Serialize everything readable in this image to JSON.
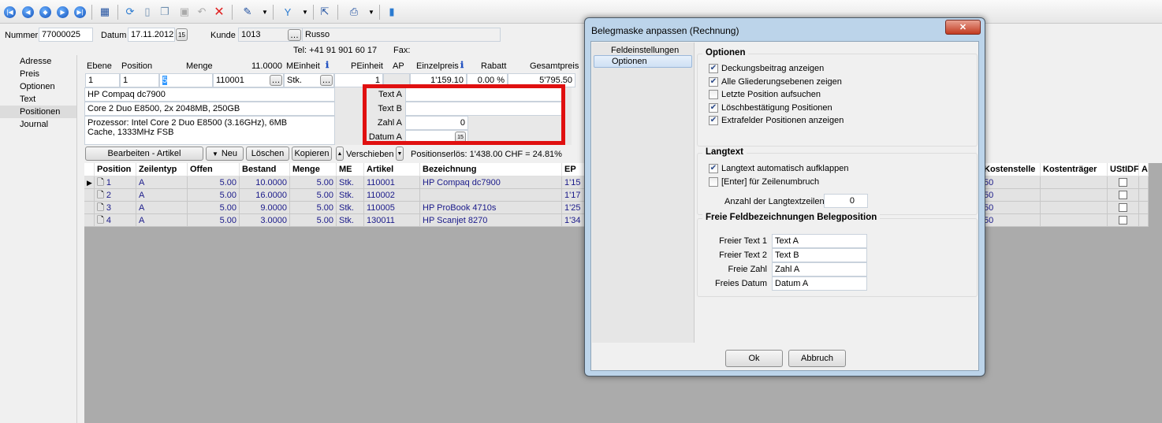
{
  "toolbar": {
    "icons": [
      "first-record-icon",
      "prev-record-icon",
      "goto-record-icon",
      "next-record-icon",
      "last-record-icon",
      "table-view-icon",
      "refresh-icon",
      "new-doc-icon",
      "copy-doc-icon",
      "save-icon",
      "undo-icon",
      "delete-icon",
      "pin-icon",
      "filter-icon",
      "pointer-icon",
      "print-icon",
      "book-icon"
    ]
  },
  "header": {
    "nummer_label": "Nummer",
    "nummer": "77000025",
    "datum_label": "Datum",
    "datum": "17.11.2012",
    "kunde_label": "Kunde",
    "kunde": "1013",
    "kunde_name": "Russo",
    "tel": "Tel: +41 91 901 60 17",
    "fax": "Fax:"
  },
  "leftnav": {
    "items": [
      "Adresse",
      "Preis",
      "Optionen",
      "Text",
      "Positionen",
      "Journal"
    ],
    "selected": "Positionen"
  },
  "pos": {
    "labels": {
      "ebene": "Ebene",
      "position": "Position",
      "menge": "Menge",
      "menge_total": "11.0000",
      "meinheit": "MEinheit",
      "peinheit": "PEinheit",
      "ap": "AP",
      "einzelpreis": "Einzelpreis",
      "rabatt": "Rabatt",
      "gesamtpreis": "Gesamtpreis"
    },
    "values": {
      "ebene": "1",
      "position": "1",
      "menge": "5",
      "artikel": "110001",
      "meinheit": "Stk.",
      "peinheit": "1",
      "einzelpreis": "1'159.10",
      "rabatt": "0.00 %",
      "gesamtpreis": "5'795.50"
    },
    "text1": "HP Compaq dc7900",
    "text2": "Core 2 Duo E8500, 2x 2048MB, 250GB",
    "langtext": "Prozessor:               Intel Core 2 Duo E8500 (3.16GHz), 6MB Cache, 1333MHz FSB",
    "extra": [
      {
        "label": "Text A",
        "value": ""
      },
      {
        "label": "Text B",
        "value": ""
      },
      {
        "label": "Zahl A",
        "value": "0"
      },
      {
        "label": "Datum A",
        "value": ""
      }
    ],
    "buttons": {
      "bearbeiten": "Bearbeiten - Artikel",
      "neu": "Neu",
      "loeschen": "Löschen",
      "kopieren": "Kopieren",
      "verschieben": "Verschieben"
    },
    "erloes": "Positionserlös:  1'438.00 CHF = 24.81%"
  },
  "grid": {
    "columns": [
      "Position",
      "Zeilentyp",
      "Offen",
      "Bestand",
      "Menge",
      "ME",
      "Artikel",
      "Bezeichnung",
      "EP"
    ],
    "right_columns": [
      "Kostenstelle",
      "Kostenträger",
      "UStIDF",
      "A"
    ],
    "rows": [
      [
        "1",
        "A",
        "5.00",
        "10.0000",
        "5.00",
        "Stk.",
        "110001",
        "HP Compaq dc7900",
        "1'15",
        "50"
      ],
      [
        "2",
        "A",
        "5.00",
        "16.0000",
        "5.00",
        "Stk.",
        "110002",
        "",
        "1'17",
        "50"
      ],
      [
        "3",
        "A",
        "5.00",
        "9.0000",
        "5.00",
        "Stk.",
        "110005",
        "HP ProBook 4710s",
        "1'25",
        "50"
      ],
      [
        "4",
        "A",
        "5.00",
        "3.0000",
        "5.00",
        "Stk.",
        "130011",
        "HP Scanjet 8270",
        "1'34",
        "50"
      ]
    ]
  },
  "dialog": {
    "title": "Belegmaske anpassen (Rechnung)",
    "nav": [
      "Feldeinstellungen",
      "Optionen"
    ],
    "nav_selected": "Optionen",
    "optionen_title": "Optionen",
    "optionen": [
      {
        "label": "Deckungsbeitrag anzeigen",
        "checked": true
      },
      {
        "label": "Alle Gliederungsebenen zeigen",
        "checked": true
      },
      {
        "label": "Letzte Position aufsuchen",
        "checked": false
      },
      {
        "label": "Löschbestätigung Positionen",
        "checked": true
      },
      {
        "label": "Extrafelder Positionen anzeigen",
        "checked": true
      }
    ],
    "langtext_title": "Langtext",
    "langtext": [
      {
        "label": "Langtext automatisch aufklappen",
        "checked": true
      },
      {
        "label": "[Enter] für Zeilenumbruch",
        "checked": false
      }
    ],
    "zeilen_label": "Anzahl der Langtextzeilen",
    "zeilen": "0",
    "freie_title": "Freie Feldbezeichnungen Belegposition",
    "freie": [
      {
        "label": "Freier Text 1",
        "value": "Text A"
      },
      {
        "label": "Freier Text 2",
        "value": "Text B"
      },
      {
        "label": "Freie Zahl",
        "value": "Zahl A"
      },
      {
        "label": "Freies Datum",
        "value": "Datum A"
      }
    ],
    "ok": "Ok",
    "abbruch": "Abbruch"
  },
  "colors": {
    "highlight": "#e01010",
    "grid_text": "#1a1a8a"
  }
}
